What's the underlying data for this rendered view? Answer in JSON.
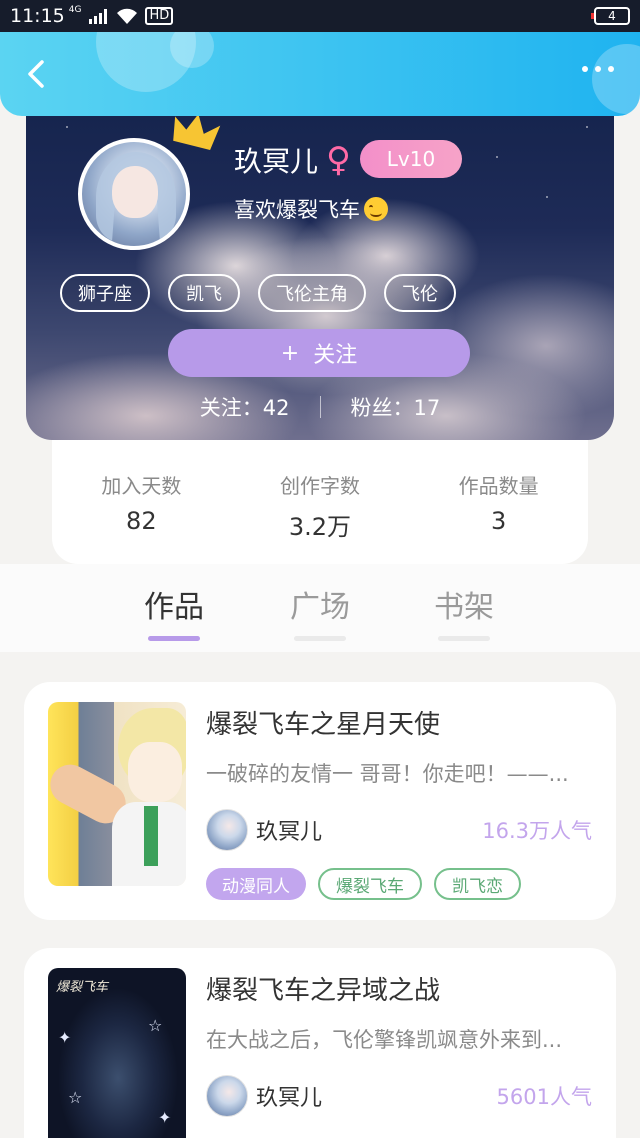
{
  "status_bar": {
    "time": "11:15",
    "network": "4G",
    "hd": "HD",
    "battery": "4"
  },
  "nav": {
    "back_icon": "back-chevron-icon",
    "more_icon": "more-dots-icon"
  },
  "profile": {
    "nickname": "玖冥儿",
    "gender_symbol": "♀",
    "level": "Lv10",
    "bio": "喜欢爆裂飞车",
    "tags": [
      "狮子座",
      "凯飞",
      "飞伦主角",
      "飞伦"
    ],
    "follow_button": {
      "icon": "+",
      "label": "关注"
    },
    "following": "关注：42",
    "fans": "粉丝：17"
  },
  "stats": [
    {
      "label": "加入天数",
      "value": "82"
    },
    {
      "label": "创作字数",
      "value": "3.2万"
    },
    {
      "label": "作品数量",
      "value": "3"
    }
  ],
  "tabs": [
    {
      "label": "作品",
      "active": true
    },
    {
      "label": "广场",
      "active": false
    },
    {
      "label": "书架",
      "active": false
    }
  ],
  "works": [
    {
      "title": "爆裂飞车之星月天使",
      "desc": "一破碎的友情一 哥哥！你走吧！——...",
      "author": "玖冥儿",
      "popularity": "16.3万人气",
      "tags": [
        "动漫同人",
        "爆裂飞车",
        "凯飞恋"
      ]
    },
    {
      "title": "爆裂飞车之异域之战",
      "desc": "在大战之后，飞伦擎锋凯飒意外来到...",
      "author": "玖冥儿",
      "popularity": "5601人气",
      "cover_text": "爆裂飞车",
      "tags": []
    }
  ]
}
